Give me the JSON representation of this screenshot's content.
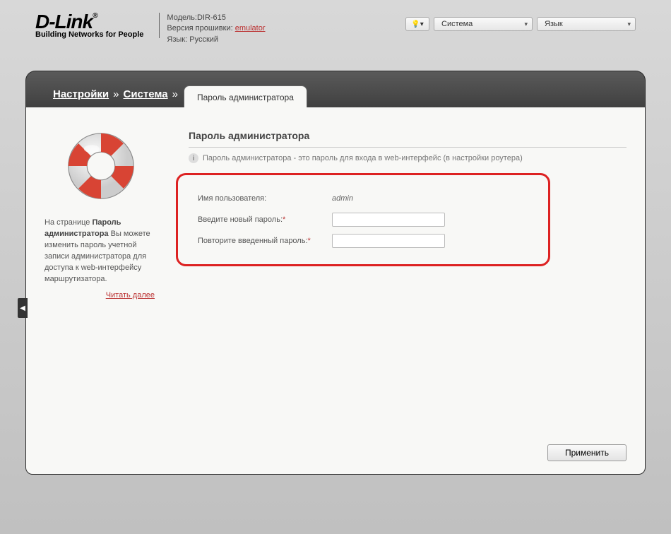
{
  "header": {
    "logo_main": "D-Link",
    "logo_sub": "Building Networks for People",
    "model_label": "Модель:",
    "model_value": "DIR-615",
    "fw_label": "Версия прошивки:",
    "fw_value": "emulator",
    "lang_label": "Язык:",
    "lang_value": "Русский",
    "system_dropdown": "Система",
    "language_dropdown": "Язык"
  },
  "breadcrumb": {
    "settings": "Настройки",
    "system": "Система",
    "sep": "»"
  },
  "tab": {
    "label": "Пароль администратора"
  },
  "sidebar": {
    "help_text_pre": "На странице ",
    "help_bold": "Пароль администратора",
    "help_text_post": " Вы можете изменить пароль учетной записи администратора для доступа к web-интерфейсу маршрутизатора.",
    "read_more": "Читать далее"
  },
  "content": {
    "title": "Пароль администратора",
    "hint": "Пароль администратора - это пароль для входа в web-интерфейс (в настройки роутера)",
    "username_label": "Имя пользователя:",
    "username_value": "admin",
    "newpass_label": "Введите новый пароль:",
    "repeatpass_label": "Повторите введенный пароль:",
    "asterisk": "*"
  },
  "buttons": {
    "apply": "Применить"
  }
}
